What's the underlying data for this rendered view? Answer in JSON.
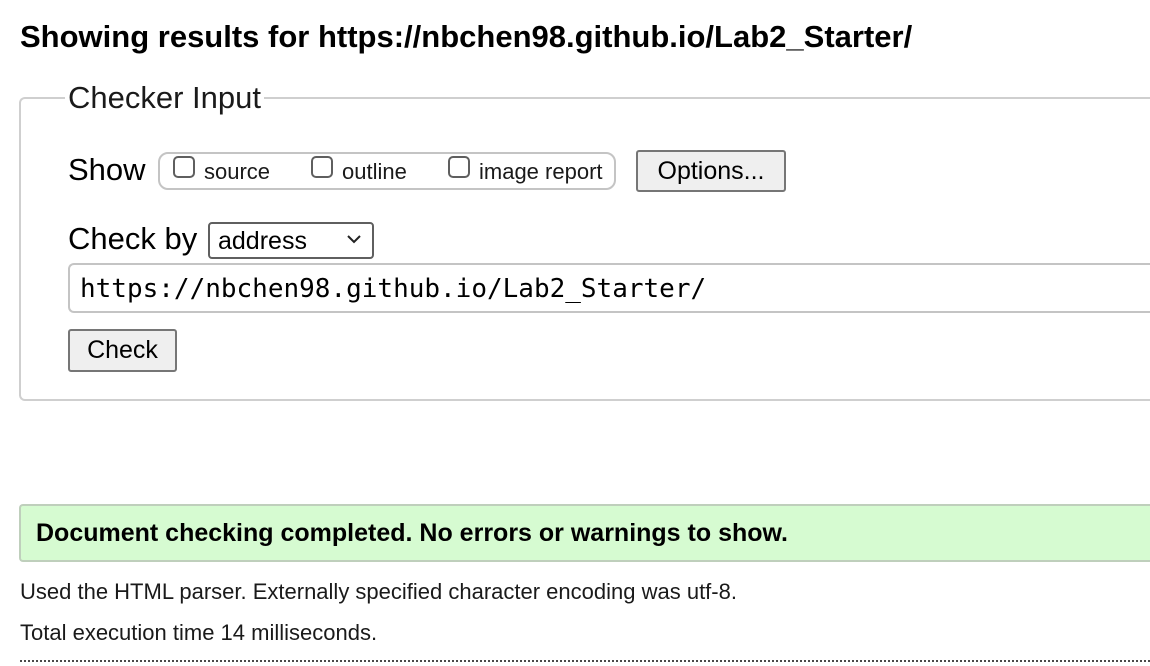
{
  "results": {
    "heading": "Showing results for https://nbchen98.github.io/Lab2_Starter/"
  },
  "checker": {
    "legend": "Checker Input",
    "show_label": "Show",
    "show_options": [
      {
        "label": "source",
        "checked": false
      },
      {
        "label": "outline",
        "checked": false
      },
      {
        "label": "image report",
        "checked": false
      }
    ],
    "options_button": "Options...",
    "check_by_label": "Check by",
    "check_by_value": "address",
    "url_value": "https://nbchen98.github.io/Lab2_Starter/",
    "check_button": "Check"
  },
  "status": {
    "message": "Document checking completed. No errors or warnings to show.",
    "color": "#d6fbd1"
  },
  "info": {
    "parser_line": "Used the HTML parser. Externally specified character encoding was utf-8.",
    "time_line": "Total execution time 14 milliseconds."
  },
  "icons": {
    "select_arrow": "chevron-down-icon"
  }
}
